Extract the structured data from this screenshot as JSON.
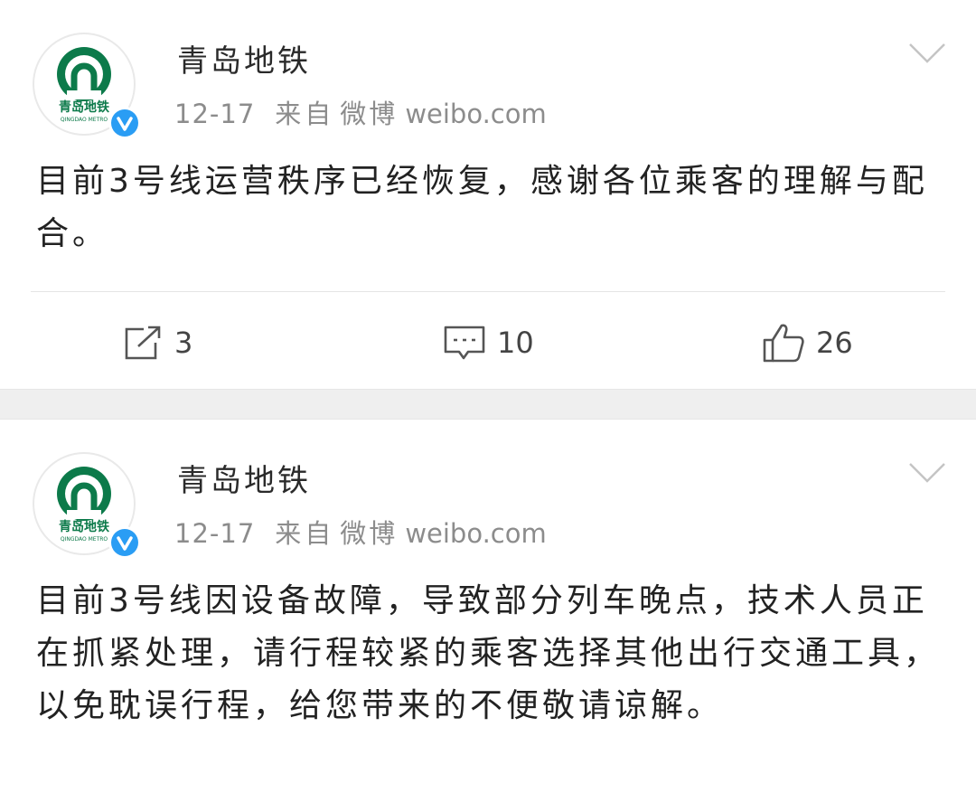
{
  "posts": [
    {
      "account_name": "青岛地铁",
      "time": "12-17",
      "from_label": "来自",
      "source_app": "微博",
      "source_domain": "weibo.com",
      "text": "目前3号线运营秩序已经恢复，感谢各位乘客的理解与配合。",
      "reposts": "3",
      "comments": "10",
      "likes": "26"
    },
    {
      "account_name": "青岛地铁",
      "time": "12-17",
      "from_label": "来自",
      "source_app": "微博",
      "source_domain": "weibo.com",
      "text": "目前3号线因设备故障，导致部分列车晚点，技术人员正在抓紧处理，请行程较紧的乘客选择其他出行交通工具，以免耽误行程，给您带来的不便敬请谅解。"
    }
  ],
  "avatar": {
    "logo_text": "青岛地铁",
    "logo_subtext": "QINGDAO METRO",
    "brand_color": "#0c7a4a"
  },
  "colors": {
    "verified_badge": "#2a9df4",
    "meta_text": "#8c8c8c",
    "separator": "#efefef"
  },
  "icons": {
    "more": "chevron-down-icon",
    "repost": "repost-icon",
    "comment": "comment-icon",
    "like": "thumbs-up-icon",
    "verified": "verified-badge-icon"
  }
}
